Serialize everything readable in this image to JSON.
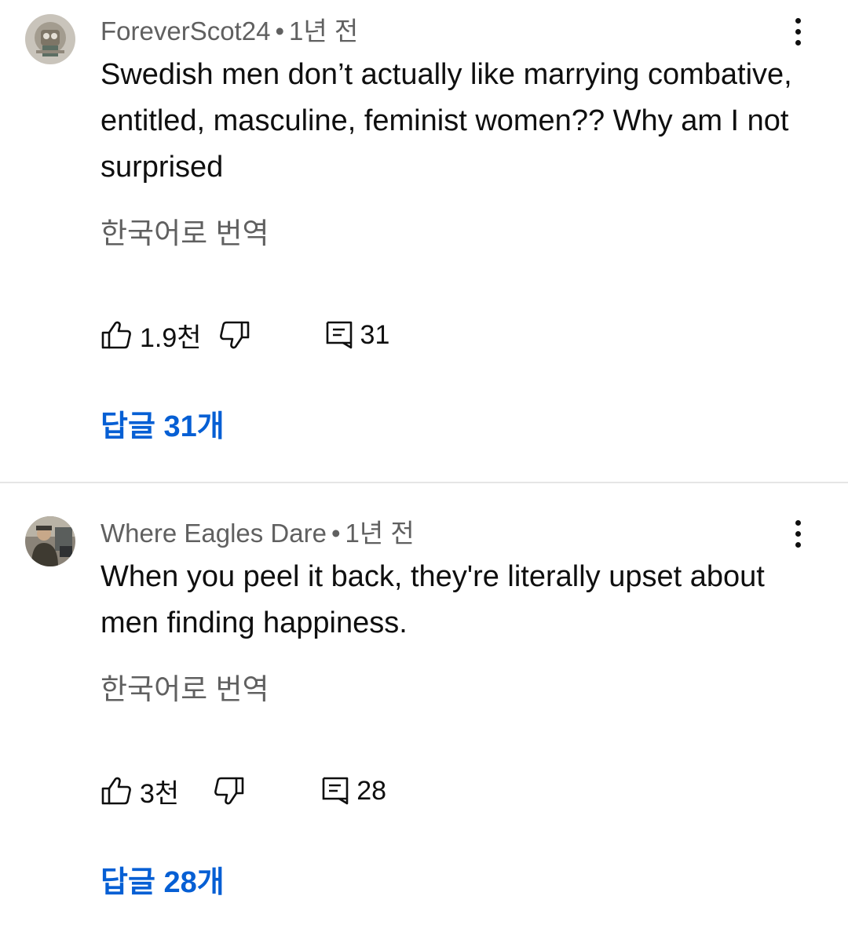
{
  "comments": [
    {
      "author": "ForeverScot24",
      "separator": "•",
      "time": "1년 전",
      "text": "Swedish men don’t actually like marrying combative, entitled, masculine, feminist women?? Why am I not surprised",
      "translate_label": "한국어로 번역",
      "likes": "1.9천",
      "reply_count": "31",
      "replies_label": "답글 31개",
      "avatar_icon": "avatar-image"
    },
    {
      "author": "Where Eagles Dare",
      "separator": "•",
      "time": "1년 전",
      "text": "When you peel it back, they're literally upset about men finding happiness.",
      "translate_label": "한국어로 번역",
      "likes": "3천",
      "reply_count": "28",
      "replies_label": "답글 28개",
      "avatar_icon": "avatar-image"
    }
  ],
  "colors": {
    "link": "#065fd4",
    "secondary_text": "#606060",
    "primary_text": "#0f0f0f",
    "divider": "#e5e5e5"
  }
}
